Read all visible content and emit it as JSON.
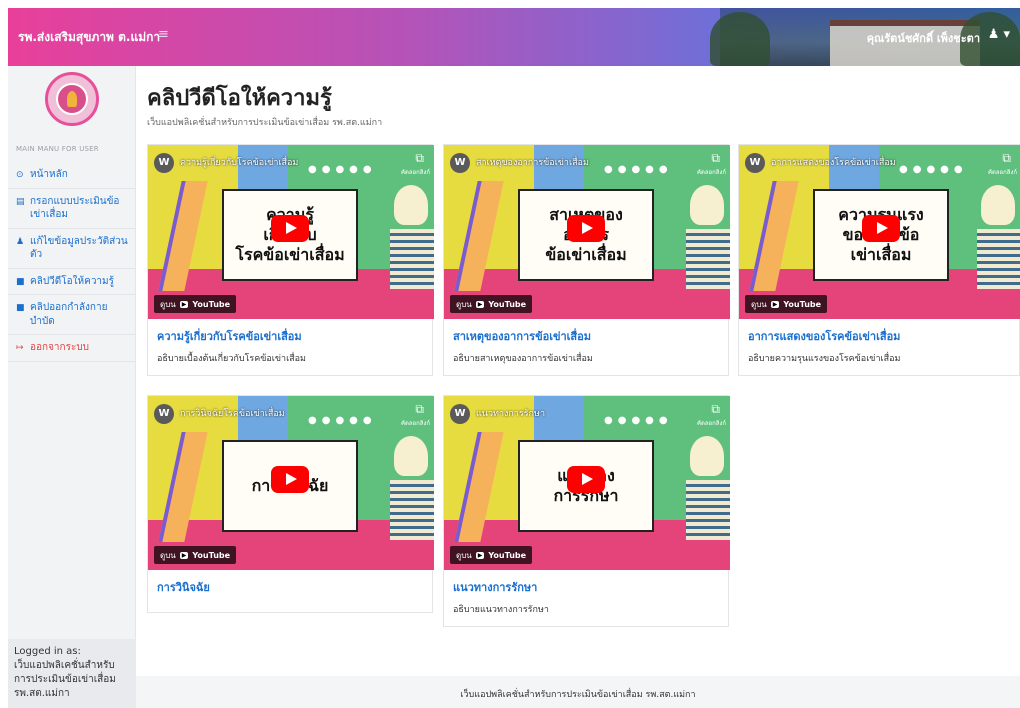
{
  "navbar": {
    "brand": "รพ.ส่งเสริมสุขภาพ ต.แม่กา",
    "menu_icon": "≡",
    "user_name": "คุณรัตน์ชศักดิ์ เพ็งชะตา",
    "user_icon": "user-icon"
  },
  "sidebar": {
    "menu_title": "MAIN MANU FOR USER",
    "items": [
      {
        "icon": "home-icon",
        "glyph": "⊙",
        "label": "หน้าหลัก"
      },
      {
        "icon": "calendar-icon",
        "glyph": "▤",
        "label": "กรอกแบบประเมินข้อเข่าเสื่อม"
      },
      {
        "icon": "user-icon",
        "glyph": "♟",
        "label": "แก้ไขข้อมูลประวัติส่วนตัว"
      },
      {
        "icon": "video-icon",
        "glyph": "■",
        "label": "คลิปวีดีโอให้ความรู้"
      },
      {
        "icon": "video-icon",
        "glyph": "■",
        "label": "คลิปออกกำลังกายบำบัด"
      },
      {
        "icon": "logout-icon",
        "glyph": "↦",
        "label": "ออกจากระบบ"
      }
    ],
    "logged_in": "Logged in as:\nเว็บแอปพลิเคชั่นสำหรับการประเมินข้อเข่าเสื่อม รพ.สต.แม่กา"
  },
  "page": {
    "title": "คลิปวีดีโอให้ความรู้",
    "subtitle": "เว็บแอปพลิเคชั่นสำหรับการประเมินข้อเข่าเสื่อม รพ.สต.แม่กา"
  },
  "videos": [
    {
      "video_title": "ความรู้เกี่ยวกับโรคข้อเข่าเสื่อม",
      "panel_text": "ความรู้\nเกี่ยวกับ\nโรคข้อเข่าเสื่อม",
      "card_title": "ความรู้เกี่ยวกับโรคข้อเข่าเสื่อม",
      "card_desc": "อธิบายเบื้องต้นเกี่ยวกับโรคข้อเข่าเสื่อม"
    },
    {
      "video_title": "สาเหตุของอาการข้อเข่าเสื่อม",
      "panel_text": "สาเหตุของ\nอาการ\nข้อเข่าเสื่อม",
      "card_title": "สาเหตุของอาการข้อเข่าเสื่อม",
      "card_desc": "อธิบายสาเหตุของอาการข้อเข่าเสื่อม"
    },
    {
      "video_title": "อาการแสดงของโรคข้อเข่าเสื่อม",
      "panel_text": "ความรุนแรง\nของโรคข้อ\nเข่าเสื่อม",
      "card_title": "อาการแสดงของโรคข้อเข่าเสื่อม",
      "card_desc": "อธิบายความรุนแรงของโรคข้อเข่าเสื่อม"
    },
    {
      "video_title": "การวินิจฉัยโรคข้อเข่าเสื่อม",
      "panel_text": "การวินิจฉัย",
      "card_title": "การวินิจฉัย",
      "card_desc": ""
    },
    {
      "video_title": "แนวทางการรักษา",
      "panel_text": "แนวทาง\nการรักษา",
      "card_title": "แนวทางการรักษา",
      "card_desc": "อธิบายแนวทางการรักษา"
    }
  ],
  "video_overlay": {
    "avatar": "W",
    "watch_on": "ดูบน",
    "youtube": "YouTube",
    "copy_label": "คัดลอกลิงก์"
  },
  "footer": "เว็บแอปพลิเคชั่นสำหรับการประเมินข้อเข่าเสื่อม รพ.สต.แม่กา"
}
